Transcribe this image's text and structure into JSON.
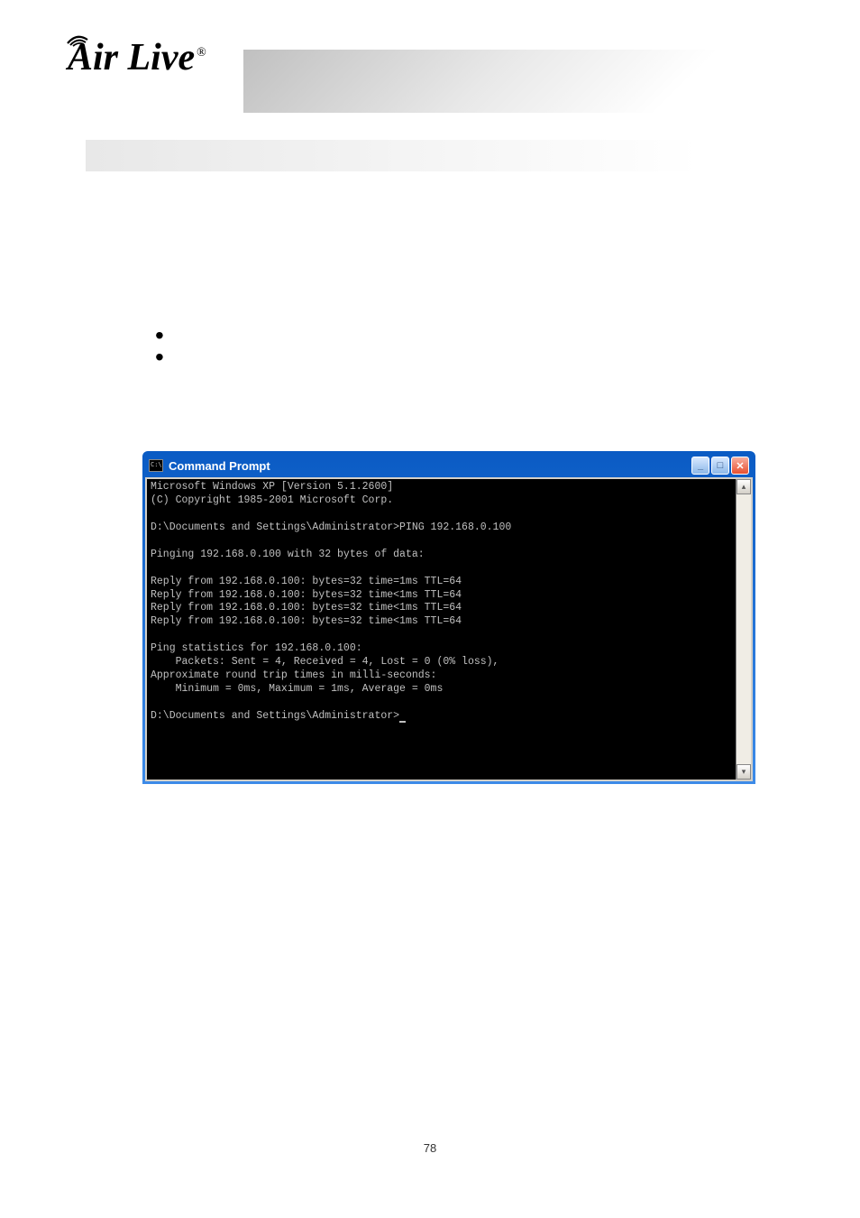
{
  "logo": {
    "text": "Air Live",
    "registered": "®"
  },
  "cmd": {
    "title": "Command Prompt",
    "lines": {
      "l1": "Microsoft Windows XP [Version 5.1.2600]",
      "l2": "(C) Copyright 1985-2001 Microsoft Corp.",
      "l3": "D:\\Documents and Settings\\Administrator>PING 192.168.0.100",
      "l4": "Pinging 192.168.0.100 with 32 bytes of data:",
      "l5": "Reply from 192.168.0.100: bytes=32 time=1ms TTL=64",
      "l6": "Reply from 192.168.0.100: bytes=32 time<1ms TTL=64",
      "l7": "Reply from 192.168.0.100: bytes=32 time<1ms TTL=64",
      "l8": "Reply from 192.168.0.100: bytes=32 time<1ms TTL=64",
      "l9": "Ping statistics for 192.168.0.100:",
      "l10": "    Packets: Sent = 4, Received = 4, Lost = 0 (0% loss),",
      "l11": "Approximate round trip times in milli-seconds:",
      "l12": "    Minimum = 0ms, Maximum = 1ms, Average = 0ms",
      "l13": "D:\\Documents and Settings\\Administrator>"
    },
    "controls": {
      "min": "_",
      "max": "□",
      "close": "✕"
    },
    "scroll": {
      "up": "▴",
      "down": "▾"
    }
  },
  "page_number": "78"
}
